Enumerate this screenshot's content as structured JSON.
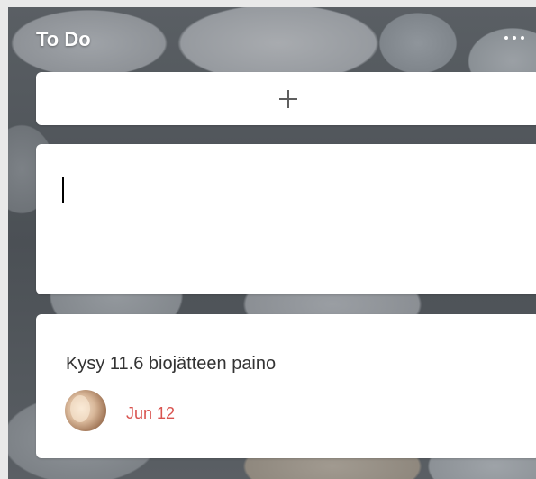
{
  "list": {
    "title": "To Do",
    "more_icon": "ellipsis-icon",
    "add_icon": "plus-icon"
  },
  "new_card": {
    "value": "",
    "placeholder": ""
  },
  "cards": [
    {
      "title": "Kysy 11.6 biojätteen paino",
      "due_date": "Jun 12",
      "due_color": "#d9534f",
      "avatar": "user-avatar"
    }
  ]
}
